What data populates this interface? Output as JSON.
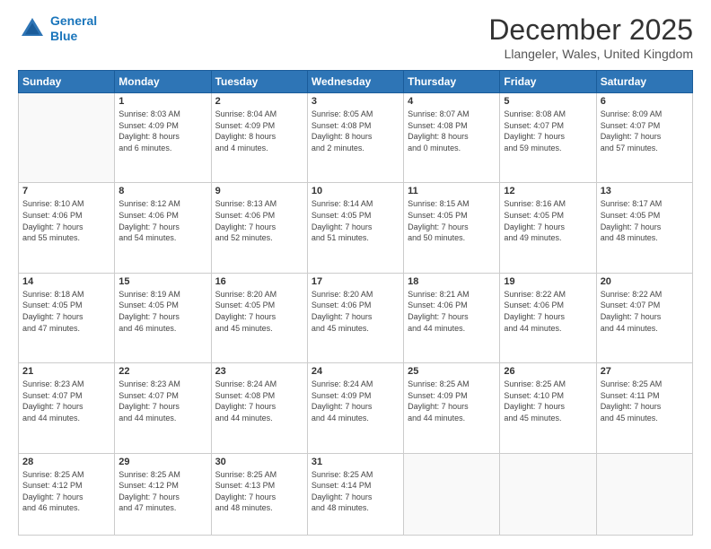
{
  "logo": {
    "line1": "General",
    "line2": "Blue"
  },
  "title": "December 2025",
  "location": "Llangeler, Wales, United Kingdom",
  "days_of_week": [
    "Sunday",
    "Monday",
    "Tuesday",
    "Wednesday",
    "Thursday",
    "Friday",
    "Saturday"
  ],
  "weeks": [
    [
      {
        "day": "",
        "info": ""
      },
      {
        "day": "1",
        "info": "Sunrise: 8:03 AM\nSunset: 4:09 PM\nDaylight: 8 hours\nand 6 minutes."
      },
      {
        "day": "2",
        "info": "Sunrise: 8:04 AM\nSunset: 4:09 PM\nDaylight: 8 hours\nand 4 minutes."
      },
      {
        "day": "3",
        "info": "Sunrise: 8:05 AM\nSunset: 4:08 PM\nDaylight: 8 hours\nand 2 minutes."
      },
      {
        "day": "4",
        "info": "Sunrise: 8:07 AM\nSunset: 4:08 PM\nDaylight: 8 hours\nand 0 minutes."
      },
      {
        "day": "5",
        "info": "Sunrise: 8:08 AM\nSunset: 4:07 PM\nDaylight: 7 hours\nand 59 minutes."
      },
      {
        "day": "6",
        "info": "Sunrise: 8:09 AM\nSunset: 4:07 PM\nDaylight: 7 hours\nand 57 minutes."
      }
    ],
    [
      {
        "day": "7",
        "info": "Sunrise: 8:10 AM\nSunset: 4:06 PM\nDaylight: 7 hours\nand 55 minutes."
      },
      {
        "day": "8",
        "info": "Sunrise: 8:12 AM\nSunset: 4:06 PM\nDaylight: 7 hours\nand 54 minutes."
      },
      {
        "day": "9",
        "info": "Sunrise: 8:13 AM\nSunset: 4:06 PM\nDaylight: 7 hours\nand 52 minutes."
      },
      {
        "day": "10",
        "info": "Sunrise: 8:14 AM\nSunset: 4:05 PM\nDaylight: 7 hours\nand 51 minutes."
      },
      {
        "day": "11",
        "info": "Sunrise: 8:15 AM\nSunset: 4:05 PM\nDaylight: 7 hours\nand 50 minutes."
      },
      {
        "day": "12",
        "info": "Sunrise: 8:16 AM\nSunset: 4:05 PM\nDaylight: 7 hours\nand 49 minutes."
      },
      {
        "day": "13",
        "info": "Sunrise: 8:17 AM\nSunset: 4:05 PM\nDaylight: 7 hours\nand 48 minutes."
      }
    ],
    [
      {
        "day": "14",
        "info": "Sunrise: 8:18 AM\nSunset: 4:05 PM\nDaylight: 7 hours\nand 47 minutes."
      },
      {
        "day": "15",
        "info": "Sunrise: 8:19 AM\nSunset: 4:05 PM\nDaylight: 7 hours\nand 46 minutes."
      },
      {
        "day": "16",
        "info": "Sunrise: 8:20 AM\nSunset: 4:05 PM\nDaylight: 7 hours\nand 45 minutes."
      },
      {
        "day": "17",
        "info": "Sunrise: 8:20 AM\nSunset: 4:06 PM\nDaylight: 7 hours\nand 45 minutes."
      },
      {
        "day": "18",
        "info": "Sunrise: 8:21 AM\nSunset: 4:06 PM\nDaylight: 7 hours\nand 44 minutes."
      },
      {
        "day": "19",
        "info": "Sunrise: 8:22 AM\nSunset: 4:06 PM\nDaylight: 7 hours\nand 44 minutes."
      },
      {
        "day": "20",
        "info": "Sunrise: 8:22 AM\nSunset: 4:07 PM\nDaylight: 7 hours\nand 44 minutes."
      }
    ],
    [
      {
        "day": "21",
        "info": "Sunrise: 8:23 AM\nSunset: 4:07 PM\nDaylight: 7 hours\nand 44 minutes."
      },
      {
        "day": "22",
        "info": "Sunrise: 8:23 AM\nSunset: 4:07 PM\nDaylight: 7 hours\nand 44 minutes."
      },
      {
        "day": "23",
        "info": "Sunrise: 8:24 AM\nSunset: 4:08 PM\nDaylight: 7 hours\nand 44 minutes."
      },
      {
        "day": "24",
        "info": "Sunrise: 8:24 AM\nSunset: 4:09 PM\nDaylight: 7 hours\nand 44 minutes."
      },
      {
        "day": "25",
        "info": "Sunrise: 8:25 AM\nSunset: 4:09 PM\nDaylight: 7 hours\nand 44 minutes."
      },
      {
        "day": "26",
        "info": "Sunrise: 8:25 AM\nSunset: 4:10 PM\nDaylight: 7 hours\nand 45 minutes."
      },
      {
        "day": "27",
        "info": "Sunrise: 8:25 AM\nSunset: 4:11 PM\nDaylight: 7 hours\nand 45 minutes."
      }
    ],
    [
      {
        "day": "28",
        "info": "Sunrise: 8:25 AM\nSunset: 4:12 PM\nDaylight: 7 hours\nand 46 minutes."
      },
      {
        "day": "29",
        "info": "Sunrise: 8:25 AM\nSunset: 4:12 PM\nDaylight: 7 hours\nand 47 minutes."
      },
      {
        "day": "30",
        "info": "Sunrise: 8:25 AM\nSunset: 4:13 PM\nDaylight: 7 hours\nand 48 minutes."
      },
      {
        "day": "31",
        "info": "Sunrise: 8:25 AM\nSunset: 4:14 PM\nDaylight: 7 hours\nand 48 minutes."
      },
      {
        "day": "",
        "info": ""
      },
      {
        "day": "",
        "info": ""
      },
      {
        "day": "",
        "info": ""
      }
    ]
  ]
}
